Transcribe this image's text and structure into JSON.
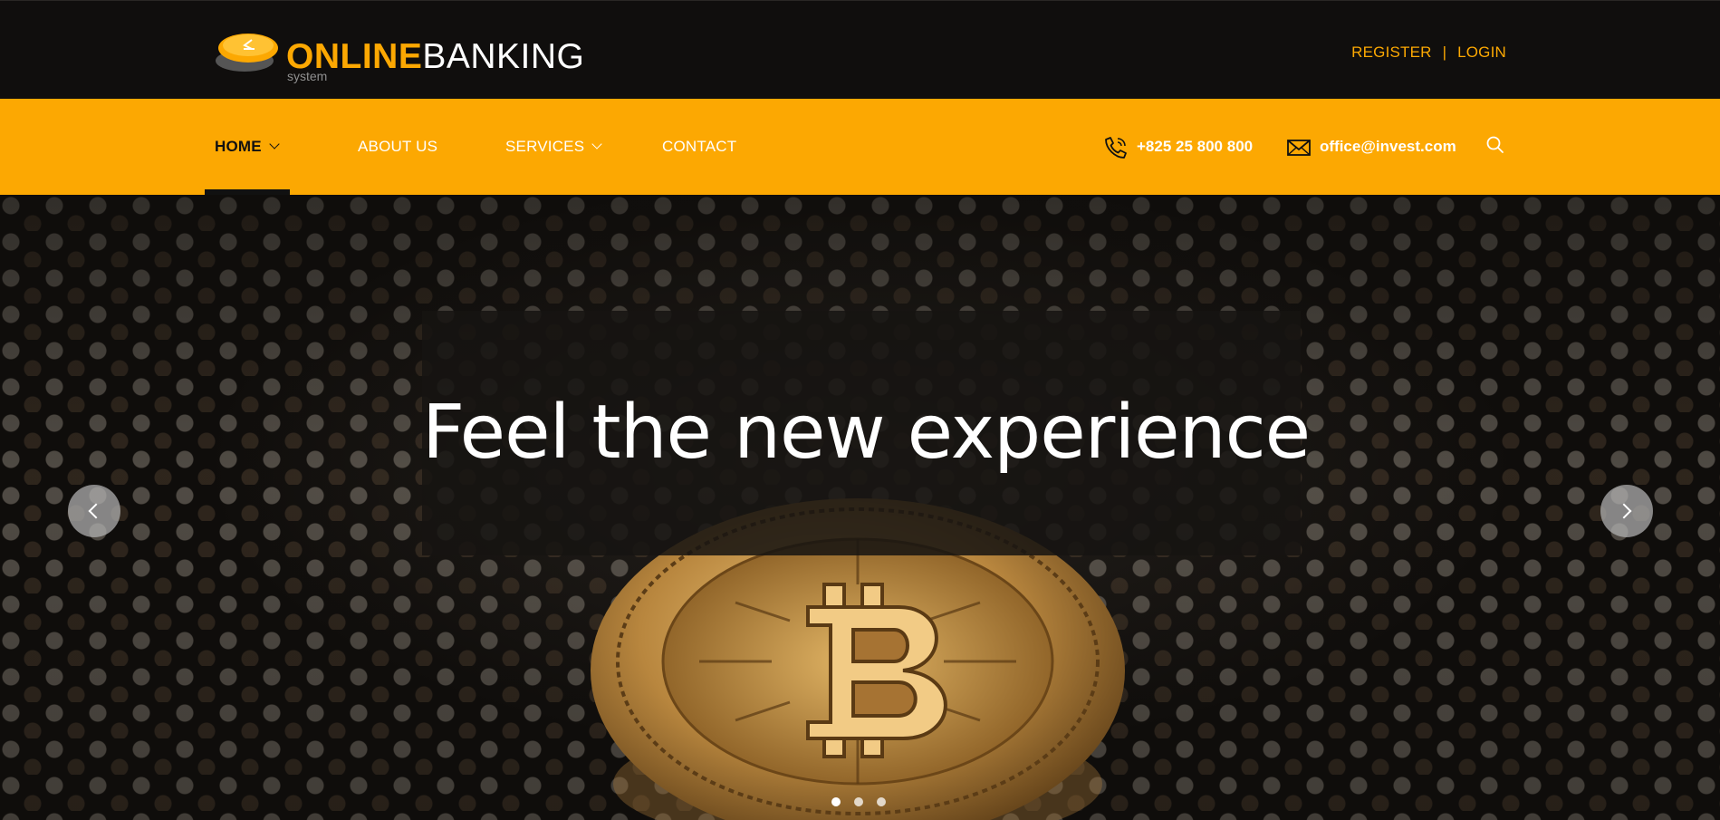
{
  "brand": {
    "word1": "ONLINE",
    "word2": "BANKING",
    "tagline": "system",
    "accent_color": "#fca802",
    "dark_color": "#100e0d"
  },
  "auth": {
    "register": "REGISTER",
    "separator": "|",
    "login": "LOGIN"
  },
  "nav": {
    "items": [
      {
        "label": "HOME",
        "active": true,
        "has_dropdown": true
      },
      {
        "label": "ABOUT US",
        "active": false,
        "has_dropdown": false
      },
      {
        "label": "SERVICES",
        "active": false,
        "has_dropdown": true
      },
      {
        "label": "CONTACT",
        "active": false,
        "has_dropdown": false
      }
    ],
    "phone": {
      "icon": "phone-icon",
      "text": "+825 25 800 800"
    },
    "email": {
      "icon": "envelope-icon",
      "text": "office@invest.com"
    },
    "search_icon": "search-icon"
  },
  "hero": {
    "caption": "Feel the new experience",
    "prev_icon": "chevron-left-icon",
    "next_icon": "chevron-right-icon",
    "slides_count": 3,
    "active_slide": 1
  }
}
